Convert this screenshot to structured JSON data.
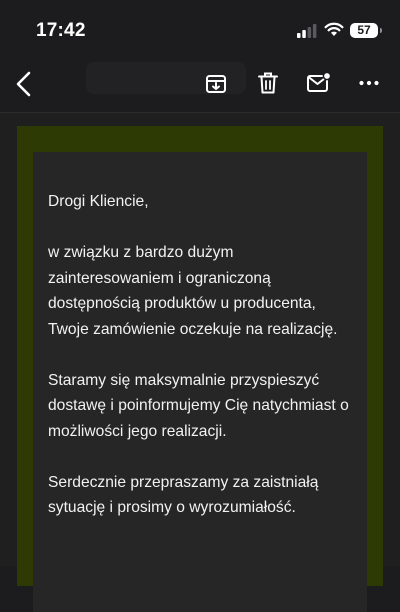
{
  "status_bar": {
    "time": "17:42",
    "battery": "57"
  },
  "toolbar": {
    "icons": [
      "back-icon",
      "archive-icon",
      "trash-icon",
      "mark-unread-icon",
      "more-icon"
    ]
  },
  "message": {
    "greeting": "Drogi Kliencie,",
    "paragraphs": [
      "w związku z bardzo dużym zainteresowaniem i ograniczoną dostępnością produktów u producenta, Twoje zamówienie oczekuje na realizację.",
      "Staramy się maksymalnie przyspieszyć dostawę i poinformujemy Cię natychmiast o możliwości jego realizacji.",
      "Serdecznie przepraszamy za zaistniałą sytuację i prosimy o wyrozumiałość."
    ]
  },
  "colors": {
    "background": "#1c1c1e",
    "frame_accent": "#2d3a03",
    "card": "#262626",
    "text": "#f2f2f2"
  }
}
